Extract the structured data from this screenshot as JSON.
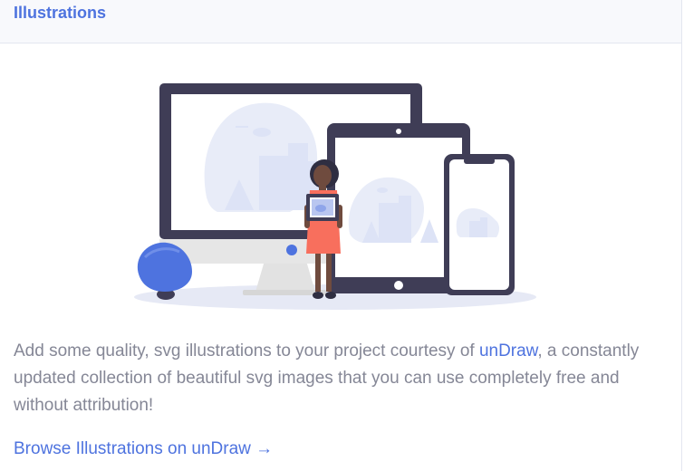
{
  "card": {
    "title": "Illustrations",
    "description_before": "Add some quality, svg illustrations to your project courtesy of ",
    "description_link": "unDraw",
    "description_after": ", a constantly updated collection of beautiful svg images that you can use completely free and without attribution!",
    "browse_link": "Browse Illustrations on unDraw →"
  },
  "colors": {
    "accent": "#4e73df",
    "text": "#858796",
    "header_bg": "#f8f9fc",
    "device_dark": "#3f3d56",
    "skin": "#6f4b3e",
    "dress": "#f86f5d"
  },
  "illustration": {
    "name": "devices-illustration"
  }
}
